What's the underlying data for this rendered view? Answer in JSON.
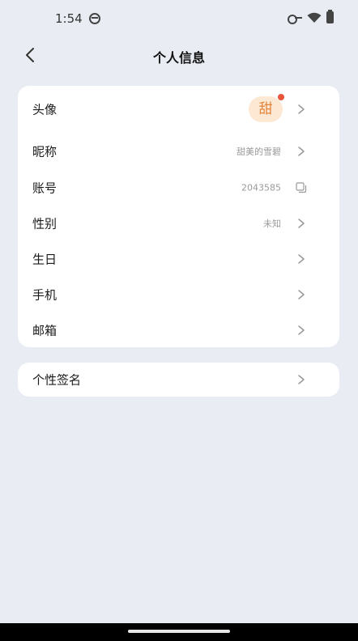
{
  "status_bar": {
    "time": "1:54"
  },
  "header": {
    "title": "个人信息"
  },
  "profile": {
    "avatar_label": "头像",
    "avatar_text": "甜",
    "nickname_label": "昵称",
    "nickname_value": "甜美的雪碧",
    "account_label": "账号",
    "account_value": "2043585",
    "gender_label": "性别",
    "gender_value": "未知",
    "birthday_label": "生日",
    "phone_label": "手机",
    "email_label": "邮箱"
  },
  "signature": {
    "label": "个性签名"
  },
  "colors": {
    "background": "#e9edf3",
    "card": "#ffffff",
    "avatar_bg": "#fde8d3",
    "avatar_text": "#e2843a",
    "badge": "#e9553a"
  }
}
